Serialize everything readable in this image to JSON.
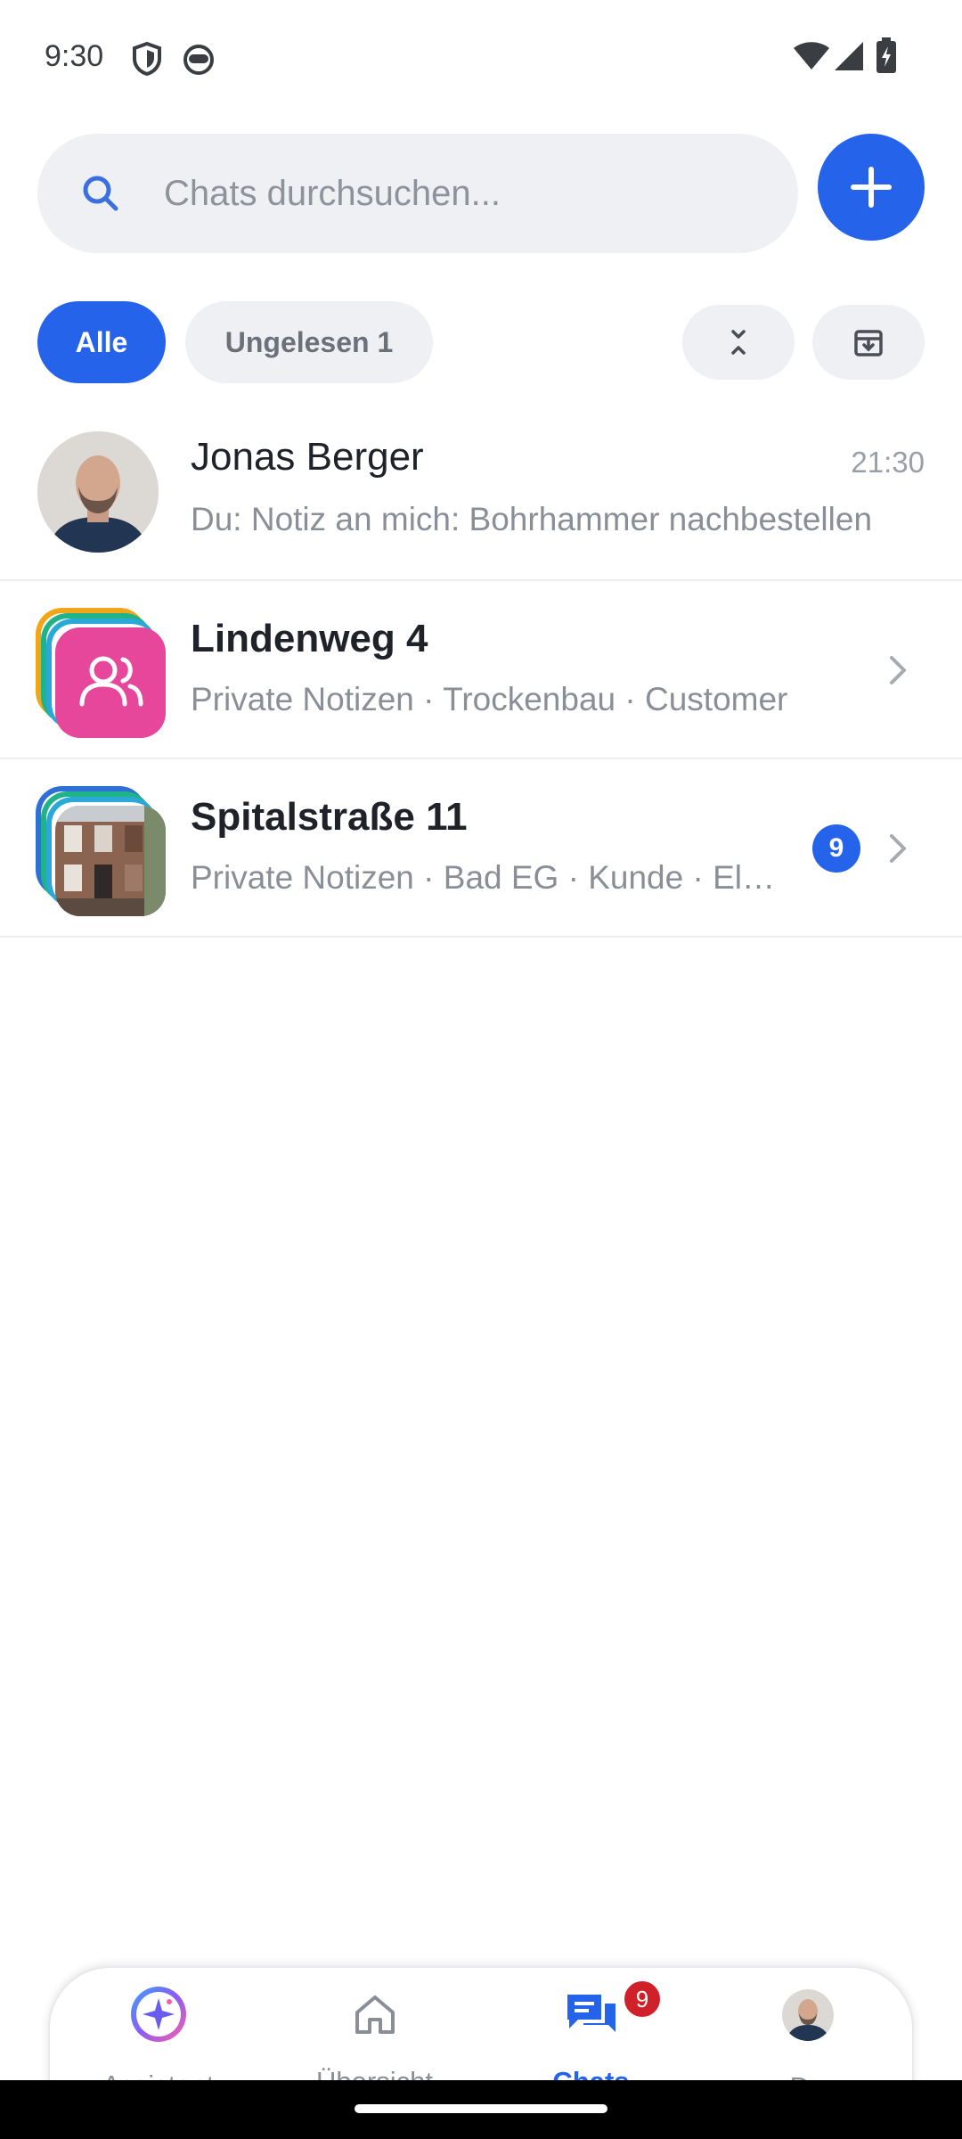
{
  "status_bar": {
    "time": "9:30"
  },
  "search": {
    "placeholder": "Chats durchsuchen..."
  },
  "filters": {
    "all_label": "Alle",
    "unread_label": "Ungelesen 1"
  },
  "chats": [
    {
      "title": "Jonas Berger",
      "subtitle": "Du: Notiz an mich: Bohrhammer nachbestellen",
      "time": "21:30"
    },
    {
      "title": "Lindenweg 4",
      "subtitle": "Private Notizen · Trockenbau · Customer",
      "icon": "group-icon",
      "accent": "#e6479a"
    },
    {
      "title": "Spitalstraße 11",
      "subtitle": "Private Notizen · Bad EG · Kunde · Elektrik",
      "unread": "9"
    }
  ],
  "bottom_nav": {
    "assistant": "Assistent",
    "overview": "Übersicht",
    "chats": "Chats",
    "chats_badge": "9",
    "profile": "Du"
  },
  "colors": {
    "primary": "#2563eb",
    "badge_red": "#d0202a",
    "chip_bg": "#eef0f4"
  }
}
